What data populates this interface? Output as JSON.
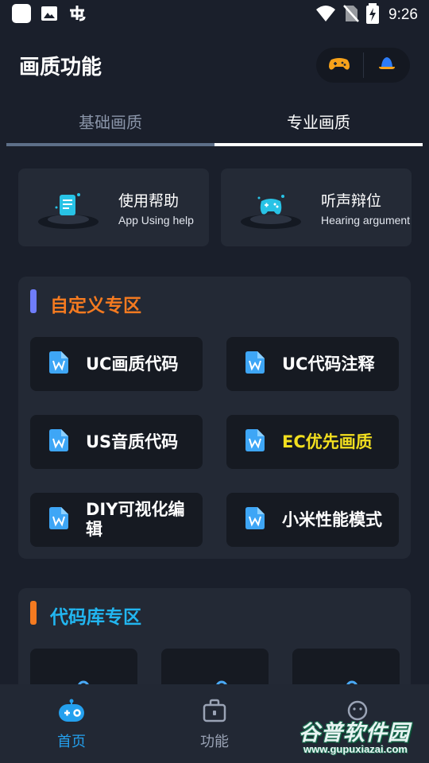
{
  "status_bar": {
    "time": "9:26"
  },
  "header": {
    "title": "画质功能"
  },
  "tabs": [
    {
      "label": "基础画质"
    },
    {
      "label": "专业画质"
    }
  ],
  "help_cards": [
    {
      "title": "使用帮助",
      "subtitle": "App Using help"
    },
    {
      "title": "听声辩位",
      "subtitle": "Hearing argument"
    }
  ],
  "custom_section": {
    "title": "自定义专区",
    "accent": "#6f7dfa",
    "title_color": "#f47a20",
    "items": [
      {
        "label": "UC画质代码"
      },
      {
        "label": "UC代码注释"
      },
      {
        "label": "US音质代码"
      },
      {
        "label": "EC优先画质",
        "highlight": "#f2df1f"
      },
      {
        "label": "DIY可视化编辑"
      },
      {
        "label": "小米性能模式"
      }
    ]
  },
  "library_section": {
    "title": "代码库专区",
    "accent": "#f47a20",
    "title_color": "#22b6f0"
  },
  "bottom_nav": [
    {
      "label": "首页",
      "active_color": "#24a0ee"
    },
    {
      "label": "功能"
    },
    {
      "label": ""
    }
  ],
  "watermark": {
    "title": "谷普软件园",
    "url": "www.gupuxiazai.com"
  }
}
